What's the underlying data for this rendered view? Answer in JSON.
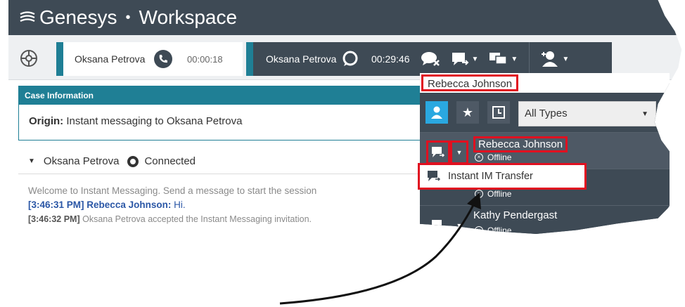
{
  "app": {
    "brand": "Genesys",
    "separator": "•",
    "name": "Workspace"
  },
  "toolbar": {
    "interactions": [
      {
        "name": "Oksana Petrova",
        "timer": "00:00:18",
        "channel": "phone-icon"
      },
      {
        "name": "Oksana Petrova",
        "timer": "00:29:46",
        "channel": "chat-icon"
      }
    ]
  },
  "case": {
    "header": "Case Information",
    "origin_label": "Origin:",
    "origin_value": "Instant messaging to Oksana Petrova"
  },
  "party": {
    "name": "Oksana Petrova",
    "status": "Connected"
  },
  "transcript": {
    "welcome": "Welcome to Instant Messaging. Send a message to start the session",
    "line2_stamp": "[3:46:31 PM]",
    "line2_who": "Rebecca Johnson:",
    "line2_text": "Hi.",
    "line3_stamp": "[3:46:32 PM]",
    "line3_text": "Oksana Petrova accepted the Instant Messaging invitation."
  },
  "team_communicator": {
    "search_value": "Rebecca Johnson",
    "filter_type": "All Types",
    "contacts": [
      {
        "name": "Rebecca Johnson",
        "status": "Offline"
      },
      {
        "name": "",
        "status": "Offline"
      },
      {
        "name": "Kathy Pendergast",
        "status": "Offline"
      }
    ],
    "menu_item": "Instant IM Transfer"
  },
  "colors": {
    "titlebar": "#3e4a55",
    "accent": "#1f7f95",
    "highlight": "#e01020",
    "people_filter": "#2aa8e0"
  }
}
